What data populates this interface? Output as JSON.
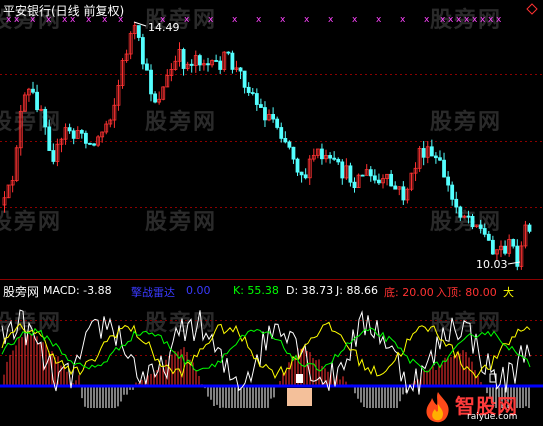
{
  "colors": {
    "background": "#000000",
    "up": "#ff3232",
    "down": "#54ffff",
    "macd_line": "#ffffff",
    "signal_line": "#ffff00",
    "third_line": "#00ff00",
    "zero_line": "#0000ff",
    "marker": "#ff44ff",
    "grid": "#8b0000"
  },
  "header": {
    "title": "平安银行(日线 前复权)"
  },
  "main_chart": {
    "high_label": "14.49",
    "low_label": "10.03"
  },
  "indicator_header": {
    "source": "股旁网",
    "macd_label": "MACD: -3.88",
    "name": "擎战雷达",
    "name_value": "0.00",
    "k": "K: 55.38",
    "d": "D: 38.73",
    "j": "J: 88.66",
    "bottom": "底: 20.00",
    "enter_top": "入顶: 80.00",
    "big": "大"
  },
  "watermarks": [
    "股旁网",
    "股旁网",
    "股旁网",
    "股旁网",
    "股旁网",
    "股旁网",
    "股旁网",
    "股旁网",
    "股旁网",
    "股旁网",
    "股旁网",
    "股旁网"
  ],
  "logo": {
    "name": "智股网",
    "url": "raiyue.com"
  }
}
